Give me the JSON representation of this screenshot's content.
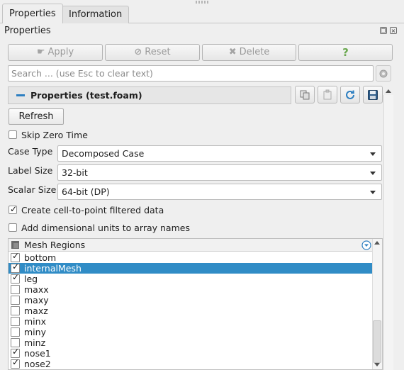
{
  "tabs": [
    {
      "label": "Properties",
      "active": true
    },
    {
      "label": "Information",
      "active": false
    }
  ],
  "panel": {
    "title": "Properties"
  },
  "toolbar": {
    "apply_label": "Apply",
    "reset_label": "Reset",
    "delete_label": "Delete",
    "help_label": "?"
  },
  "search": {
    "placeholder": "Search ... (use Esc to clear text)"
  },
  "section": {
    "title": "Properties (test.foam)"
  },
  "refresh_label": "Refresh",
  "skip_zero_time": {
    "label": "Skip Zero Time",
    "checked": false
  },
  "fields": [
    {
      "label": "Case Type",
      "value": "Decomposed Case"
    },
    {
      "label": "Label Size",
      "value": "32-bit"
    },
    {
      "label": "Scalar Size",
      "value": "64-bit (DP)"
    }
  ],
  "cell_to_point": {
    "label": "Create cell-to-point filtered data",
    "checked": true
  },
  "dim_units": {
    "label": "Add dimensional units to array names",
    "checked": false
  },
  "mesh_regions": {
    "header": "Mesh Regions",
    "rows": [
      {
        "name": "bottom",
        "checked": true,
        "selected": false
      },
      {
        "name": "internalMesh",
        "checked": true,
        "selected": true
      },
      {
        "name": "leg",
        "checked": true,
        "selected": false
      },
      {
        "name": "maxx",
        "checked": false,
        "selected": false
      },
      {
        "name": "maxy",
        "checked": false,
        "selected": false
      },
      {
        "name": "maxz",
        "checked": false,
        "selected": false
      },
      {
        "name": "minx",
        "checked": false,
        "selected": false
      },
      {
        "name": "miny",
        "checked": false,
        "selected": false
      },
      {
        "name": "minz",
        "checked": false,
        "selected": false
      },
      {
        "name": "nose1",
        "checked": true,
        "selected": false
      },
      {
        "name": "nose2",
        "checked": true,
        "selected": false
      }
    ]
  },
  "colors": {
    "selection": "#308cc6",
    "accent_minus": "#2d7fc1",
    "help_icon": "#6aa84f"
  }
}
